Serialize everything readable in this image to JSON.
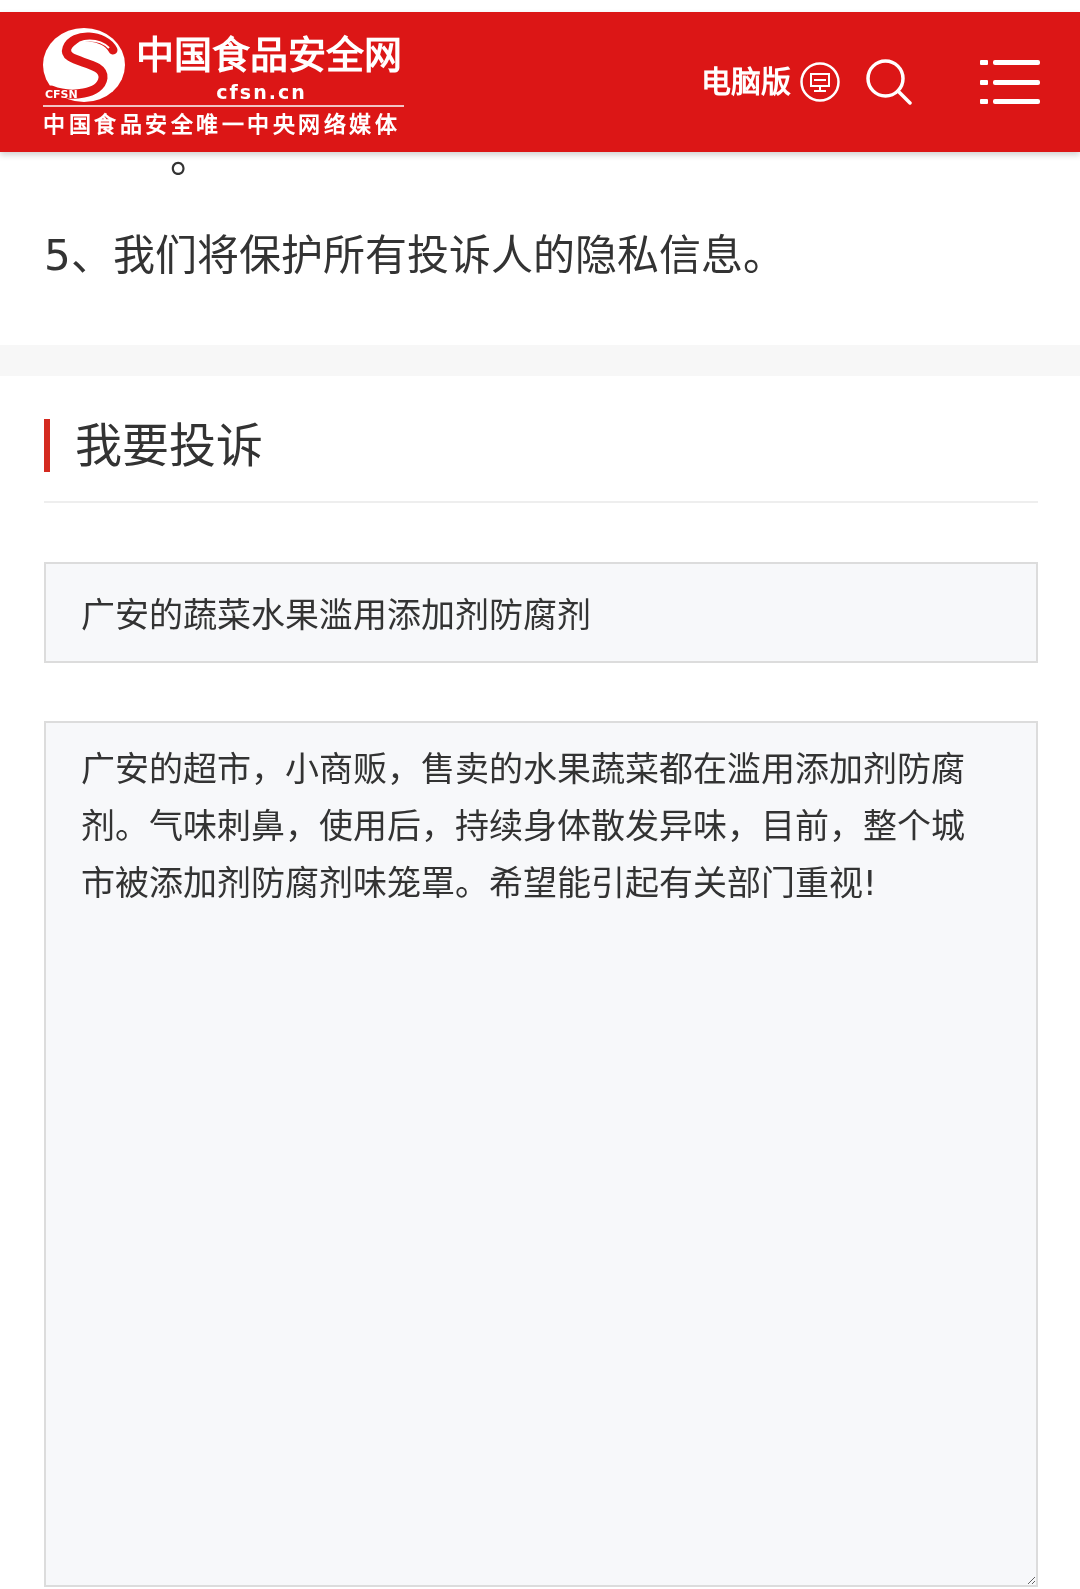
{
  "header": {
    "logo": {
      "emblem_text": "CFSN",
      "name": "中国食品安全网",
      "domain": "cfsn.cn",
      "slogan": "中国食品安全唯一中央网络媒体"
    },
    "desktop_link": "电脑版"
  },
  "notice": {
    "paragraphs": [
      "。",
      "5、我们将保护所有投诉人的隐私信息。"
    ]
  },
  "complaint_form": {
    "title": "我要投诉",
    "subject": {
      "value": "广安的蔬菜水果滥用添加剂防腐剂"
    },
    "details": {
      "value": "广安的超市，小商贩，售卖的水果蔬菜都在滥用添加剂防腐剂。气味刺鼻，使用后，持续身体散发异味，目前，整个城市被添加剂防腐剂味笼罩。希望能引起有关部门重视!"
    }
  }
}
